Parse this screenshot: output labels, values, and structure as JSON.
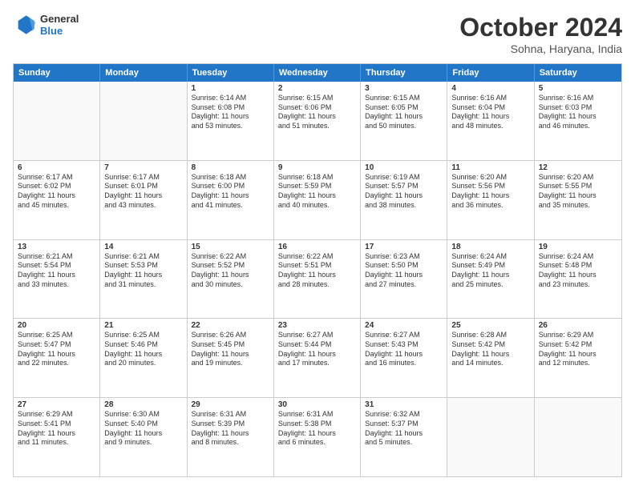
{
  "logo": {
    "line1": "General",
    "line2": "Blue"
  },
  "title": "October 2024",
  "subtitle": "Sohna, Haryana, India",
  "days": [
    "Sunday",
    "Monday",
    "Tuesday",
    "Wednesday",
    "Thursday",
    "Friday",
    "Saturday"
  ],
  "weeks": [
    [
      {
        "day": "",
        "lines": []
      },
      {
        "day": "",
        "lines": []
      },
      {
        "day": "1",
        "lines": [
          "Sunrise: 6:14 AM",
          "Sunset: 6:08 PM",
          "Daylight: 11 hours",
          "and 53 minutes."
        ]
      },
      {
        "day": "2",
        "lines": [
          "Sunrise: 6:15 AM",
          "Sunset: 6:06 PM",
          "Daylight: 11 hours",
          "and 51 minutes."
        ]
      },
      {
        "day": "3",
        "lines": [
          "Sunrise: 6:15 AM",
          "Sunset: 6:05 PM",
          "Daylight: 11 hours",
          "and 50 minutes."
        ]
      },
      {
        "day": "4",
        "lines": [
          "Sunrise: 6:16 AM",
          "Sunset: 6:04 PM",
          "Daylight: 11 hours",
          "and 48 minutes."
        ]
      },
      {
        "day": "5",
        "lines": [
          "Sunrise: 6:16 AM",
          "Sunset: 6:03 PM",
          "Daylight: 11 hours",
          "and 46 minutes."
        ]
      }
    ],
    [
      {
        "day": "6",
        "lines": [
          "Sunrise: 6:17 AM",
          "Sunset: 6:02 PM",
          "Daylight: 11 hours",
          "and 45 minutes."
        ]
      },
      {
        "day": "7",
        "lines": [
          "Sunrise: 6:17 AM",
          "Sunset: 6:01 PM",
          "Daylight: 11 hours",
          "and 43 minutes."
        ]
      },
      {
        "day": "8",
        "lines": [
          "Sunrise: 6:18 AM",
          "Sunset: 6:00 PM",
          "Daylight: 11 hours",
          "and 41 minutes."
        ]
      },
      {
        "day": "9",
        "lines": [
          "Sunrise: 6:18 AM",
          "Sunset: 5:59 PM",
          "Daylight: 11 hours",
          "and 40 minutes."
        ]
      },
      {
        "day": "10",
        "lines": [
          "Sunrise: 6:19 AM",
          "Sunset: 5:57 PM",
          "Daylight: 11 hours",
          "and 38 minutes."
        ]
      },
      {
        "day": "11",
        "lines": [
          "Sunrise: 6:20 AM",
          "Sunset: 5:56 PM",
          "Daylight: 11 hours",
          "and 36 minutes."
        ]
      },
      {
        "day": "12",
        "lines": [
          "Sunrise: 6:20 AM",
          "Sunset: 5:55 PM",
          "Daylight: 11 hours",
          "and 35 minutes."
        ]
      }
    ],
    [
      {
        "day": "13",
        "lines": [
          "Sunrise: 6:21 AM",
          "Sunset: 5:54 PM",
          "Daylight: 11 hours",
          "and 33 minutes."
        ]
      },
      {
        "day": "14",
        "lines": [
          "Sunrise: 6:21 AM",
          "Sunset: 5:53 PM",
          "Daylight: 11 hours",
          "and 31 minutes."
        ]
      },
      {
        "day": "15",
        "lines": [
          "Sunrise: 6:22 AM",
          "Sunset: 5:52 PM",
          "Daylight: 11 hours",
          "and 30 minutes."
        ]
      },
      {
        "day": "16",
        "lines": [
          "Sunrise: 6:22 AM",
          "Sunset: 5:51 PM",
          "Daylight: 11 hours",
          "and 28 minutes."
        ]
      },
      {
        "day": "17",
        "lines": [
          "Sunrise: 6:23 AM",
          "Sunset: 5:50 PM",
          "Daylight: 11 hours",
          "and 27 minutes."
        ]
      },
      {
        "day": "18",
        "lines": [
          "Sunrise: 6:24 AM",
          "Sunset: 5:49 PM",
          "Daylight: 11 hours",
          "and 25 minutes."
        ]
      },
      {
        "day": "19",
        "lines": [
          "Sunrise: 6:24 AM",
          "Sunset: 5:48 PM",
          "Daylight: 11 hours",
          "and 23 minutes."
        ]
      }
    ],
    [
      {
        "day": "20",
        "lines": [
          "Sunrise: 6:25 AM",
          "Sunset: 5:47 PM",
          "Daylight: 11 hours",
          "and 22 minutes."
        ]
      },
      {
        "day": "21",
        "lines": [
          "Sunrise: 6:25 AM",
          "Sunset: 5:46 PM",
          "Daylight: 11 hours",
          "and 20 minutes."
        ]
      },
      {
        "day": "22",
        "lines": [
          "Sunrise: 6:26 AM",
          "Sunset: 5:45 PM",
          "Daylight: 11 hours",
          "and 19 minutes."
        ]
      },
      {
        "day": "23",
        "lines": [
          "Sunrise: 6:27 AM",
          "Sunset: 5:44 PM",
          "Daylight: 11 hours",
          "and 17 minutes."
        ]
      },
      {
        "day": "24",
        "lines": [
          "Sunrise: 6:27 AM",
          "Sunset: 5:43 PM",
          "Daylight: 11 hours",
          "and 16 minutes."
        ]
      },
      {
        "day": "25",
        "lines": [
          "Sunrise: 6:28 AM",
          "Sunset: 5:42 PM",
          "Daylight: 11 hours",
          "and 14 minutes."
        ]
      },
      {
        "day": "26",
        "lines": [
          "Sunrise: 6:29 AM",
          "Sunset: 5:42 PM",
          "Daylight: 11 hours",
          "and 12 minutes."
        ]
      }
    ],
    [
      {
        "day": "27",
        "lines": [
          "Sunrise: 6:29 AM",
          "Sunset: 5:41 PM",
          "Daylight: 11 hours",
          "and 11 minutes."
        ]
      },
      {
        "day": "28",
        "lines": [
          "Sunrise: 6:30 AM",
          "Sunset: 5:40 PM",
          "Daylight: 11 hours",
          "and 9 minutes."
        ]
      },
      {
        "day": "29",
        "lines": [
          "Sunrise: 6:31 AM",
          "Sunset: 5:39 PM",
          "Daylight: 11 hours",
          "and 8 minutes."
        ]
      },
      {
        "day": "30",
        "lines": [
          "Sunrise: 6:31 AM",
          "Sunset: 5:38 PM",
          "Daylight: 11 hours",
          "and 6 minutes."
        ]
      },
      {
        "day": "31",
        "lines": [
          "Sunrise: 6:32 AM",
          "Sunset: 5:37 PM",
          "Daylight: 11 hours",
          "and 5 minutes."
        ]
      },
      {
        "day": "",
        "lines": []
      },
      {
        "day": "",
        "lines": []
      }
    ]
  ]
}
